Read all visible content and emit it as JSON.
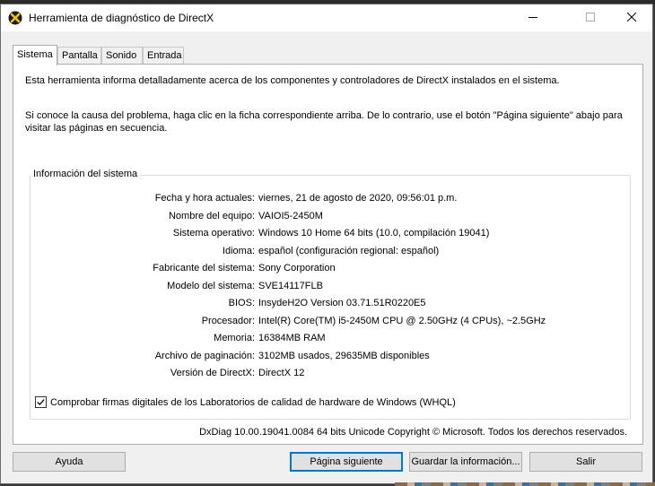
{
  "window": {
    "title": "Herramienta de diagnóstico de DirectX"
  },
  "tabs": [
    {
      "label": "Sistema"
    },
    {
      "label": "Pantalla"
    },
    {
      "label": "Sonido"
    },
    {
      "label": "Entrada"
    }
  ],
  "intro": {
    "line1": "Esta herramienta informa detalladamente acerca de los componentes y controladores de DirectX instalados en el sistema.",
    "line2": "Si conoce la causa del problema, haga clic en la ficha correspondiente arriba. De lo contrario, use el botón \"Página siguiente\" abajo para visitar las páginas en secuencia."
  },
  "system_info": {
    "heading": "Información del sistema",
    "rows": [
      {
        "label": "Fecha y hora actuales:",
        "value": "viernes, 21 de agosto de 2020, 09:56:01 p.m."
      },
      {
        "label": "Nombre del equipo:",
        "value": "VAIOI5-2450M"
      },
      {
        "label": "Sistema operativo:",
        "value": "Windows 10 Home 64 bits (10.0, compilación 19041)"
      },
      {
        "label": "Idioma:",
        "value": "español (configuración regional: español)"
      },
      {
        "label": "Fabricante del sistema:",
        "value": "Sony Corporation"
      },
      {
        "label": "Modelo del sistema:",
        "value": "SVE14117FLB"
      },
      {
        "label": "BIOS:",
        "value": "InsydeH2O Version 03.71.51R0220E5"
      },
      {
        "label": "Procesador:",
        "value": "Intel(R) Core(TM) i5-2450M CPU @ 2.50GHz (4 CPUs), ~2.5GHz"
      },
      {
        "label": "Memoria:",
        "value": "16384MB RAM"
      },
      {
        "label": "Archivo de paginación:",
        "value": "3102MB usados, 29635MB disponibles"
      },
      {
        "label": "Versión de DirectX:",
        "value": "DirectX 12"
      }
    ],
    "whql_checkbox": {
      "label": "Comprobar firmas digitales de los Laboratorios de calidad de hardware de Windows (WHQL)",
      "checked": true
    }
  },
  "footer_text": "DxDiag 10.00.19041.0084 64 bits Unicode  Copyright © Microsoft. Todos los derechos reservados.",
  "buttons": {
    "help": "Ayuda",
    "next_page": "Página siguiente",
    "save_info": "Guardar la información...",
    "exit": "Salir"
  },
  "colors": {
    "accent": "#0078d7",
    "window_bg": "#f0f0f0",
    "panel_bg": "#ffffff"
  },
  "icons": {
    "app": "directx-x-icon",
    "min": "minimize-icon",
    "max": "maximize-icon",
    "close": "close-icon",
    "check": "checkmark-icon"
  }
}
